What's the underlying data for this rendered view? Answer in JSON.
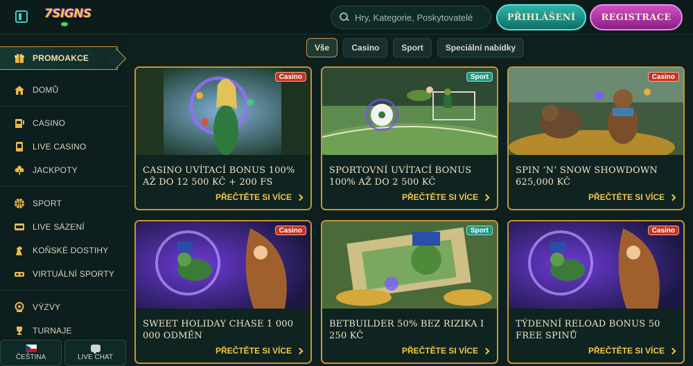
{
  "header": {
    "logo_text": "7SIGNS",
    "search_placeholder": "Hry, Kategorie, Poskytovatelé",
    "login_label": "PŘIHLÁŠENÍ",
    "register_label": "REGISTRACE"
  },
  "sidebar": {
    "promo_label": "PROMOAKCE",
    "items": [
      {
        "label": "DOMŮ",
        "icon": "home-icon"
      },
      {
        "label": "CASINO",
        "icon": "slot-machine-icon"
      },
      {
        "label": "LIVE CASINO",
        "icon": "cards-icon"
      },
      {
        "label": "JACKPOTY",
        "icon": "clover-icon"
      },
      {
        "label": "SPORT",
        "icon": "basketball-icon"
      },
      {
        "label": "LIVE SÁZENÍ",
        "icon": "live-icon"
      },
      {
        "label": "KOŇSKÉ DOSTIHY",
        "icon": "horse-icon"
      },
      {
        "label": "VIRTUÁLNÍ SPORTY",
        "icon": "vr-headset-icon"
      },
      {
        "label": "VÝZVY",
        "icon": "target-icon"
      },
      {
        "label": "TURNAJE",
        "icon": "trophy-icon"
      }
    ],
    "language_label": "ČEŠTINA",
    "chat_label": "LIVE CHAT"
  },
  "filters": {
    "chips": [
      "Vše",
      "Casino",
      "Sport",
      "Speciální nabídky"
    ],
    "active": "Vše"
  },
  "cards": [
    {
      "tag": "Casino",
      "title": "CASINO UVÍTACÍ BONUS 100% AŽ DO 12 500 KČ + 200 FS",
      "more": "PŘEČTĚTE SI VÍCE"
    },
    {
      "tag": "Sport",
      "title": "SPORTOVNÍ UVÍTACÍ BONUS 100% AŽ DO 2 500 KČ",
      "more": "PŘEČTĚTE SI VÍCE"
    },
    {
      "tag": "Casino",
      "title": "SPIN ‘N’ SNOW SHOWDOWN 625,000 KČ",
      "more": "PŘEČTĚTE SI VÍCE"
    },
    {
      "tag": "Casino",
      "title": "SWEET HOLIDAY CHASE 1 000 000 ODMĚN",
      "more": "PŘEČTĚTE SI VÍCE"
    },
    {
      "tag": "Sport",
      "title": "BETBUILDER 50% BEZ RIZIKA I 250 KČ",
      "more": "PŘEČTĚTE SI VÍCE"
    },
    {
      "tag": "Casino",
      "title": "TÝDENNÍ RELOAD BONUS 50 FREE SPINŮ",
      "more": "PŘEČTĚTE SI VÍCE"
    }
  ],
  "colors": {
    "accent_gold": "#c8962e",
    "login_teal": "#2fb3a9",
    "register_magenta": "#d04fc4",
    "casino_tag": "#c4341f",
    "sport_tag": "#1f9a84"
  }
}
